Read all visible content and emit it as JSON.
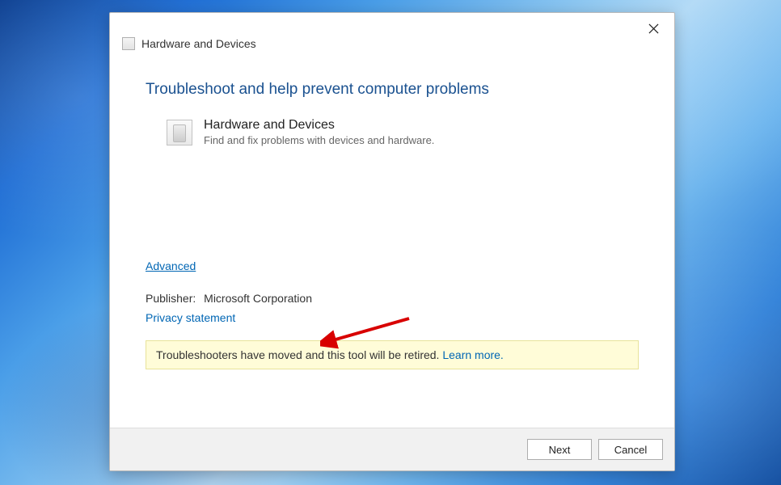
{
  "window": {
    "title": "Hardware and Devices"
  },
  "main": {
    "heading": "Troubleshoot and help prevent computer problems",
    "section": {
      "title": "Hardware and Devices",
      "description": "Find and fix problems with devices and hardware."
    },
    "advanced_link": "Advanced",
    "publisher": {
      "label": "Publisher:",
      "value": "Microsoft Corporation"
    },
    "privacy_link": "Privacy statement",
    "notice": {
      "message": "Troubleshooters have moved and this tool will be retired. ",
      "learn_more": "Learn more."
    }
  },
  "buttons": {
    "next": "Next",
    "cancel": "Cancel"
  }
}
